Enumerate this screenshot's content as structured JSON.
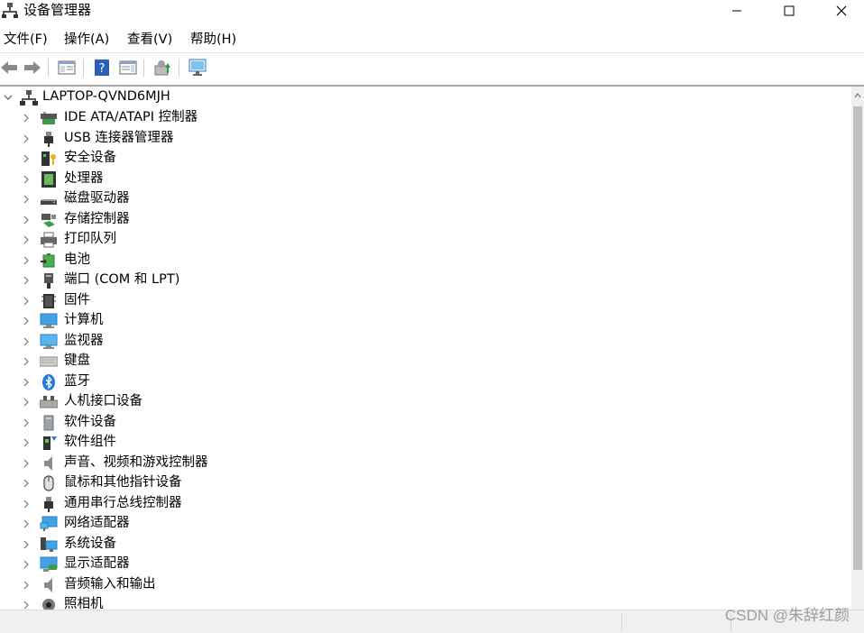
{
  "window": {
    "title": "设备管理器",
    "controls": [
      "minimize",
      "maximize",
      "close"
    ]
  },
  "menu": {
    "items": [
      "文件(F)",
      "操作(A)",
      "查看(V)",
      "帮助(H)"
    ]
  },
  "toolbar": {
    "buttons": [
      "back-arrow-icon",
      "forward-arrow-icon",
      "properties-pane-icon",
      "help-icon",
      "details-pane-icon",
      "update-driver-icon",
      "scan-hardware-icon"
    ]
  },
  "tree": {
    "root": "LAPTOP-QVND6MJH",
    "nodes": [
      {
        "label": "IDE ATA/ATAPI 控制器",
        "icon": "ide-controller-icon"
      },
      {
        "label": "USB 连接器管理器",
        "icon": "usb-connector-icon"
      },
      {
        "label": "安全设备",
        "icon": "security-device-icon"
      },
      {
        "label": "处理器",
        "icon": "processor-icon"
      },
      {
        "label": "磁盘驱动器",
        "icon": "disk-drive-icon"
      },
      {
        "label": "存储控制器",
        "icon": "storage-controller-icon"
      },
      {
        "label": "打印队列",
        "icon": "printer-icon"
      },
      {
        "label": "电池",
        "icon": "battery-icon"
      },
      {
        "label": "端口 (COM 和 LPT)",
        "icon": "port-icon"
      },
      {
        "label": "固件",
        "icon": "firmware-icon"
      },
      {
        "label": "计算机",
        "icon": "computer-icon"
      },
      {
        "label": "监视器",
        "icon": "monitor-icon"
      },
      {
        "label": "键盘",
        "icon": "keyboard-icon"
      },
      {
        "label": "蓝牙",
        "icon": "bluetooth-icon"
      },
      {
        "label": "人机接口设备",
        "icon": "hid-icon"
      },
      {
        "label": "软件设备",
        "icon": "software-device-icon"
      },
      {
        "label": "软件组件",
        "icon": "software-component-icon"
      },
      {
        "label": "声音、视频和游戏控制器",
        "icon": "sound-icon"
      },
      {
        "label": "鼠标和其他指针设备",
        "icon": "mouse-icon"
      },
      {
        "label": "通用串行总线控制器",
        "icon": "usb-controller-icon"
      },
      {
        "label": "网络适配器",
        "icon": "network-adapter-icon"
      },
      {
        "label": "系统设备",
        "icon": "system-device-icon"
      },
      {
        "label": "显示适配器",
        "icon": "display-adapter-icon"
      },
      {
        "label": "音频输入和输出",
        "icon": "audio-io-icon"
      },
      {
        "label": "照相机",
        "icon": "camera-icon"
      }
    ]
  },
  "watermark": "CSDN @朱辞红颜"
}
